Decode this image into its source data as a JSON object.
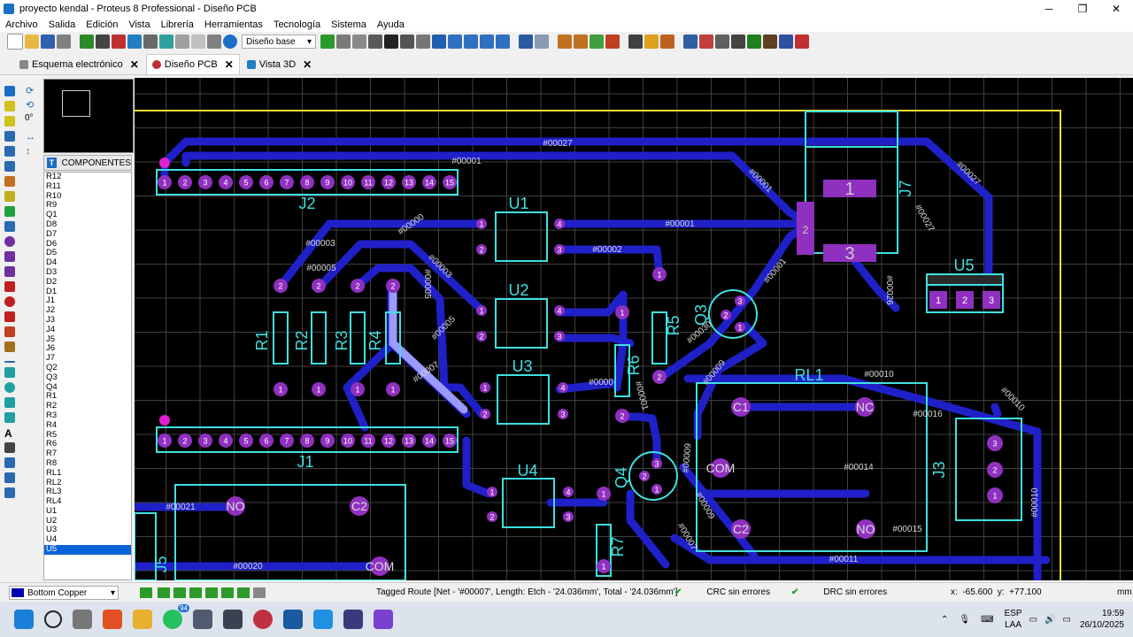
{
  "window": {
    "title": "proyecto kendal - Proteus 8 Professional - Diseño PCB",
    "minimize": "─",
    "maximize": "❐",
    "close": "✕"
  },
  "menu": [
    "Archivo",
    "Salida",
    "Edición",
    "Vista",
    "Librería",
    "Herramientas",
    "Tecnología",
    "Sistema",
    "Ayuda"
  ],
  "toolbar": {
    "layer_select": "Diseño base"
  },
  "tabs": [
    {
      "label": "Esquema electrónico",
      "active": false
    },
    {
      "label": "Diseño PCB",
      "active": true
    },
    {
      "label": "Vista 3D",
      "active": false
    }
  ],
  "rotation": "0°",
  "components": {
    "header": "COMPONENTES",
    "items": [
      "R12",
      "R11",
      "R10",
      "R9",
      "Q1",
      "D8",
      "D7",
      "D6",
      "D5",
      "D4",
      "D3",
      "D2",
      "D1",
      "J1",
      "J2",
      "J3",
      "J4",
      "J5",
      "J6",
      "J7",
      "Q2",
      "Q3",
      "Q4",
      "R1",
      "R2",
      "R3",
      "R4",
      "R5",
      "R6",
      "R7",
      "R8",
      "RL1",
      "RL2",
      "RL3",
      "RL4",
      "U1",
      "U2",
      "U3",
      "U4",
      "U5"
    ],
    "selected": "U5"
  },
  "pcb": {
    "nets": [
      "#00027",
      "#00001",
      "#00001",
      "#00000",
      "#00003",
      "#00005",
      "#00003",
      "#00005",
      "#00002",
      "#00001",
      "#00001",
      "#00027",
      "#00027",
      "#00026",
      "#00030",
      "#00009",
      "#00007",
      "#00005",
      "#0000",
      "#00001",
      "#00009",
      "#00009",
      "#00007",
      "#00010",
      "#00010",
      "#00016",
      "#00014",
      "#00015",
      "#00011",
      "#00010",
      "#00021",
      "#00020"
    ],
    "refs": [
      "J2",
      "J1",
      "U1",
      "U2",
      "U3",
      "U4",
      "U5",
      "Q3",
      "Q4",
      "R1",
      "R2",
      "R3",
      "R4",
      "R5",
      "R6",
      "R7",
      "RL1",
      "J7",
      "J3",
      "J5"
    ],
    "pad_labels": [
      "NC",
      "C1",
      "COM",
      "C2",
      "NO",
      "NO",
      "C2",
      "COM"
    ],
    "j2_pins": [
      "1",
      "2",
      "3",
      "4",
      "5",
      "6",
      "7",
      "8",
      "9",
      "10",
      "11",
      "12",
      "13",
      "14",
      "15"
    ],
    "j1_pins": [
      "1",
      "2",
      "3",
      "4",
      "5",
      "6",
      "7",
      "8",
      "9",
      "10",
      "11",
      "12",
      "13",
      "14",
      "15"
    ]
  },
  "status": {
    "layer": "Bottom Copper",
    "message": "Tagged Route [Net - '#00007', Length: Etch - '24.036mm', Total - '24.036mm']",
    "crc": "CRC sin errores",
    "drc": "DRC sin errores",
    "x_label": "x:",
    "x": "-65.600",
    "y_label": "y:",
    "y": "+77.100",
    "unit": "mm"
  },
  "taskbar": {
    "lang": "ESP",
    "lang2": "LAA",
    "time": "19:59",
    "date": "26/10/2025",
    "badge": "94"
  },
  "colors": {
    "copper": "#2020c8",
    "silk": "#40e0e0",
    "pad": "#9030c0",
    "board": "#e8e030",
    "grid": "#404040"
  }
}
